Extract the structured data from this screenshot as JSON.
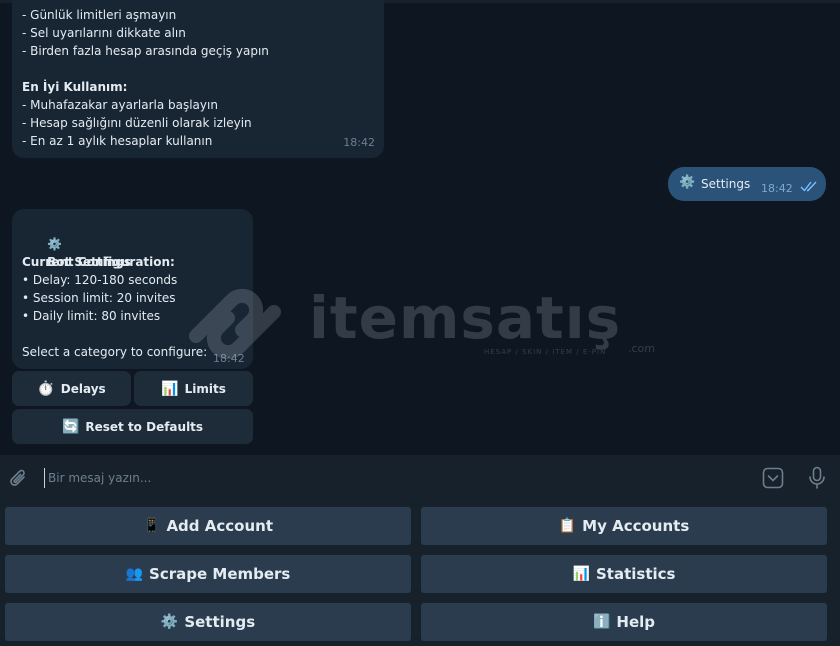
{
  "message_tips": {
    "lines": [
      "- Günlük limitleri aşmayın",
      "- Sel uyarılarını dikkate alın",
      "- Birden fazla hesap arasında geçiş yapın",
      "",
      "En İyi Kullanım:",
      "- Muhafazakar ayarlarla başlayın",
      "- Hesap sağlığını düzenli olarak izleyin",
      "- En az 1 aylık hesaplar kullanın"
    ],
    "time": "18:42"
  },
  "message_out": {
    "emoji": "⚙️",
    "text": "Settings",
    "time": "18:42"
  },
  "message_settings": {
    "title_emoji": "⚙️",
    "title": "Bot Settings",
    "config_heading": "Current Configuration:",
    "config_lines": [
      "• Delay: 120-180 seconds",
      "• Session limit: 20 invites",
      "• Daily limit: 80 invites"
    ],
    "prompt": "Select a category to configure:",
    "time": "18:42"
  },
  "inline_keyboard": {
    "delays": {
      "emoji": "⏱️",
      "label": "Delays"
    },
    "limits": {
      "emoji": "📊",
      "label": "Limits"
    },
    "reset": {
      "emoji": "🔄",
      "label": "Reset to Defaults"
    }
  },
  "watermark": {
    "brand": "itemsatış",
    "tagline": "HESAP / SKIN / ITEM / E-PIN",
    "suffix": ".com"
  },
  "input": {
    "placeholder": "Bir mesaj yazın..."
  },
  "reply_keyboard": {
    "add_account": {
      "emoji": "📱",
      "label": "Add Account"
    },
    "my_accounts": {
      "emoji": "📋",
      "label": "My Accounts"
    },
    "scrape_members": {
      "emoji": "👥",
      "label": "Scrape Members"
    },
    "statistics": {
      "emoji": "📊",
      "label": "Statistics"
    },
    "settings": {
      "emoji": "⚙️",
      "label": "Settings"
    },
    "help": {
      "emoji": "ℹ️",
      "label": "Help"
    }
  },
  "colors": {
    "background": "#0e1621",
    "incoming_bubble": "#182533",
    "outgoing_bubble": "#2b5278",
    "panel": "#17212b",
    "reply_button": "#2b3c4e"
  }
}
